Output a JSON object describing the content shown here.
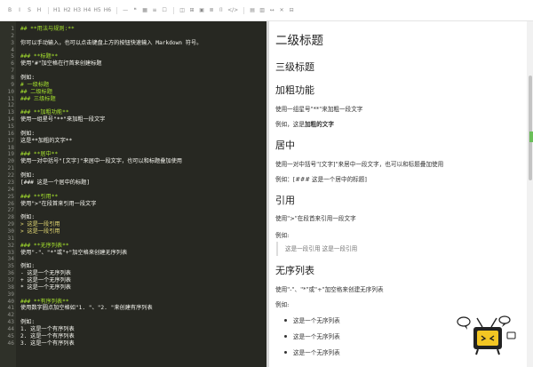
{
  "toolbar": {
    "buttons": [
      "B",
      "I",
      "S",
      "H",
      "H1",
      "H2",
      "H3",
      "H4",
      "H5",
      "H6",
      "—",
      "❝",
      "▦",
      "≡",
      "☐",
      "◫",
      "⊞",
      "▣",
      "≣",
      "⌷",
      "</>",
      "▤",
      "▥",
      "↔",
      "✕",
      "⊟"
    ]
  },
  "editor": {
    "lines": [
      {
        "n": "1",
        "t": "## **用法与规则:**",
        "k": "heading"
      },
      {
        "n": "2",
        "t": "",
        "k": ""
      },
      {
        "n": "3",
        "t": "你可以手动输入，也可以点击键盘上方的按钮快速输入 Markdown 符号。",
        "k": ""
      },
      {
        "n": "4",
        "t": "",
        "k": ""
      },
      {
        "n": "5",
        "t": "### **标题**",
        "k": "heading"
      },
      {
        "n": "6",
        "t": "使用\"#\"加空格在行首来创建标题",
        "k": ""
      },
      {
        "n": "7",
        "t": "",
        "k": ""
      },
      {
        "n": "8",
        "t": "例如:",
        "k": ""
      },
      {
        "n": "9",
        "t": "# 一级标题",
        "k": "heading"
      },
      {
        "n": "10",
        "t": "## 二级标题",
        "k": "heading"
      },
      {
        "n": "11",
        "t": "### 三级标题",
        "k": "heading"
      },
      {
        "n": "12",
        "t": "",
        "k": ""
      },
      {
        "n": "13",
        "t": "### **加粗功能**",
        "k": "heading"
      },
      {
        "n": "14",
        "t": "使用一组星号\"**\"来加粗一段文字",
        "k": ""
      },
      {
        "n": "15",
        "t": "",
        "k": ""
      },
      {
        "n": "16",
        "t": "例如:",
        "k": ""
      },
      {
        "n": "17",
        "t": "这是**加粗的文字**",
        "k": ""
      },
      {
        "n": "18",
        "t": "",
        "k": ""
      },
      {
        "n": "19",
        "t": "### **居中**",
        "k": "heading"
      },
      {
        "n": "20",
        "t": "使用一对中括号\"[文字]\"来居中一段文字，也可以和标题叠加使用",
        "k": ""
      },
      {
        "n": "21",
        "t": "",
        "k": ""
      },
      {
        "n": "22",
        "t": "例如:",
        "k": ""
      },
      {
        "n": "23",
        "t": "[### 这是一个居中的标题]",
        "k": ""
      },
      {
        "n": "24",
        "t": "",
        "k": ""
      },
      {
        "n": "25",
        "t": "### **引用**",
        "k": "heading"
      },
      {
        "n": "26",
        "t": "使用\">\"在段首来引用一段文字",
        "k": ""
      },
      {
        "n": "27",
        "t": "",
        "k": ""
      },
      {
        "n": "28",
        "t": "例如:",
        "k": ""
      },
      {
        "n": "29",
        "t": "> 这是一段引用",
        "k": "quote"
      },
      {
        "n": "30",
        "t": "> 这是一段引用",
        "k": "quote"
      },
      {
        "n": "31",
        "t": "",
        "k": ""
      },
      {
        "n": "32",
        "t": "### **无序列表**",
        "k": "heading"
      },
      {
        "n": "33",
        "t": "使用\"-\"、\"*\"或\"+\"加空格来创建无序列表",
        "k": ""
      },
      {
        "n": "34",
        "t": "",
        "k": ""
      },
      {
        "n": "35",
        "t": "例如:",
        "k": ""
      },
      {
        "n": "36",
        "t": "- 这是一个无序列表",
        "k": "list"
      },
      {
        "n": "37",
        "t": "+ 这是一个无序列表",
        "k": "list"
      },
      {
        "n": "38",
        "t": "* 这是一个无序列表",
        "k": "list"
      },
      {
        "n": "39",
        "t": "",
        "k": ""
      },
      {
        "n": "40",
        "t": "### **有序列表**",
        "k": "heading"
      },
      {
        "n": "41",
        "t": "使用数字圆点加空格如\"1. \"、\"2. \"来创建有序列表",
        "k": ""
      },
      {
        "n": "42",
        "t": "",
        "k": ""
      },
      {
        "n": "43",
        "t": "例如:",
        "k": ""
      },
      {
        "n": "44",
        "t": "1. 这是一个有序列表",
        "k": "list"
      },
      {
        "n": "45",
        "t": "2. 这是一个有序列表",
        "k": "list"
      },
      {
        "n": "46",
        "t": "3. 这是一个有序列表",
        "k": "list"
      }
    ]
  },
  "preview": {
    "h2": "二级标题",
    "h3": "三级标题",
    "bold_title": "加粗功能",
    "bold_desc": "使用一组星号\"**\"来加粗一段文字",
    "bold_example_prefix": "例如，这是",
    "bold_example_bold": "加粗的文字",
    "center_title": "居中",
    "center_desc": "使用一对中括号\"[文字]\"来居中一段文字，也可以和标题叠加使用",
    "center_example": "例如：[### 这是一个居中的标题]",
    "quote_title": "引用",
    "quote_desc": "使用\">\"在段首来引用一段文字",
    "quote_example_label": "例如:",
    "quote_text": "这是一段引用 这是一段引用",
    "ul_title": "无序列表",
    "ul_desc": "使用\"-\"、\"*\"或\"+\"加空格来创建无序列表",
    "ul_example_label": "例如:",
    "ul_items": [
      "这是一个无序列表",
      "这是一个无序列表",
      "这是一个无序列表"
    ]
  },
  "colors": {
    "editor_bg": "#272822",
    "heading": "#a6e22e",
    "quote": "#e6db74",
    "accent_tab": "#6bbf59"
  },
  "icons": {
    "mascot": "tv-mascot-icon"
  }
}
